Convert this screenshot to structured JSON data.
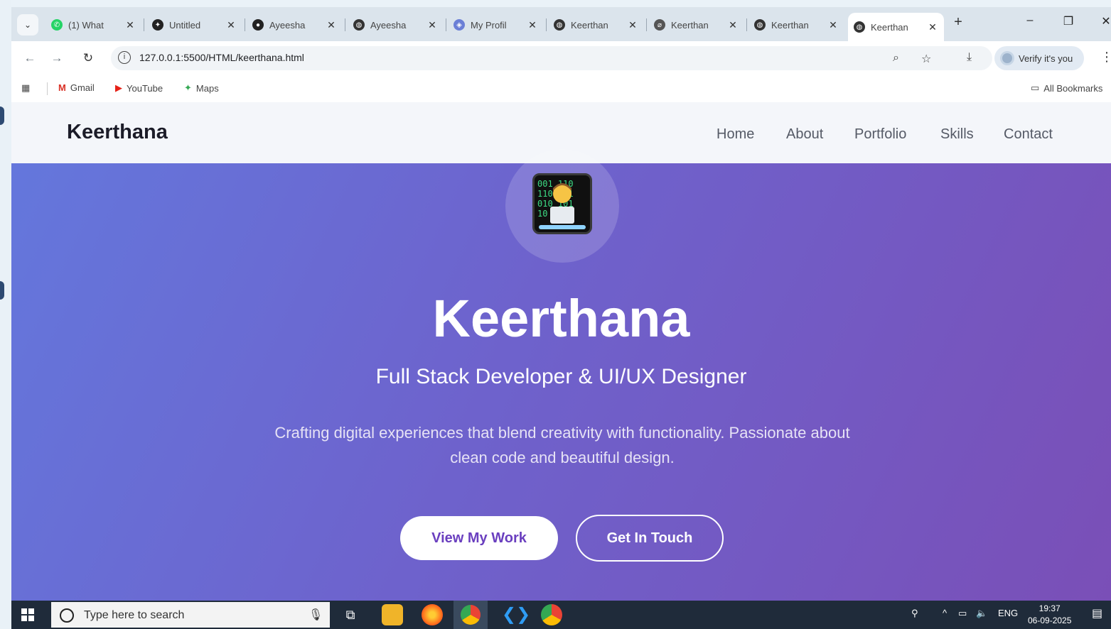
{
  "browser": {
    "tabs": [
      {
        "title": "(1) What",
        "favicon": "whatsapp-icon",
        "color": "#25d366",
        "active": false
      },
      {
        "title": "Untitled",
        "favicon": "web-icon",
        "color": "#222222",
        "active": false
      },
      {
        "title": "Ayeesha",
        "favicon": "github-icon",
        "color": "#222222",
        "active": false
      },
      {
        "title": "Ayeesha",
        "favicon": "globe-icon",
        "color": "#333333",
        "active": false
      },
      {
        "title": "My Profil",
        "favicon": "profile-icon",
        "color": "#6b7fd6",
        "active": false
      },
      {
        "title": "Keerthan",
        "favicon": "globe-icon",
        "color": "#333333",
        "active": false
      },
      {
        "title": "Keerthan",
        "favicon": "netlify-icon",
        "color": "#333333",
        "active": false
      },
      {
        "title": "Keerthan",
        "favicon": "globe-icon",
        "color": "#333333",
        "active": false
      },
      {
        "title": "Keerthan",
        "favicon": "globe-icon",
        "color": "#333333",
        "active": true
      }
    ],
    "url": "127.0.0.1:5500/HTML/keerthana.html",
    "verify_label": "Verify it's you",
    "bookmarks": [
      {
        "label": "Gmail",
        "icon": "gmail-icon"
      },
      {
        "label": "YouTube",
        "icon": "youtube-icon"
      },
      {
        "label": "Maps",
        "icon": "maps-icon"
      }
    ],
    "all_bookmarks": "All Bookmarks"
  },
  "site": {
    "logo": "Keerthana",
    "nav": [
      "Home",
      "About",
      "Portfolio",
      "Skills",
      "Contact"
    ],
    "hero": {
      "title": "Keerthana",
      "subtitle": "Full Stack Developer & UI/UX Designer",
      "description": "Crafting digital experiences that blend creativity with functionality. Passionate about clean code and beautiful design.",
      "primary_button": "View My Work",
      "secondary_button": "Get In Touch"
    }
  },
  "taskbar": {
    "search_placeholder": "Type here to search",
    "language": "ENG",
    "time": "19:37",
    "date": "06-09-2025"
  },
  "colors": {
    "hero_start": "#6477dc",
    "hero_end": "#7a4fb7",
    "accent": "#6a3fbf"
  }
}
